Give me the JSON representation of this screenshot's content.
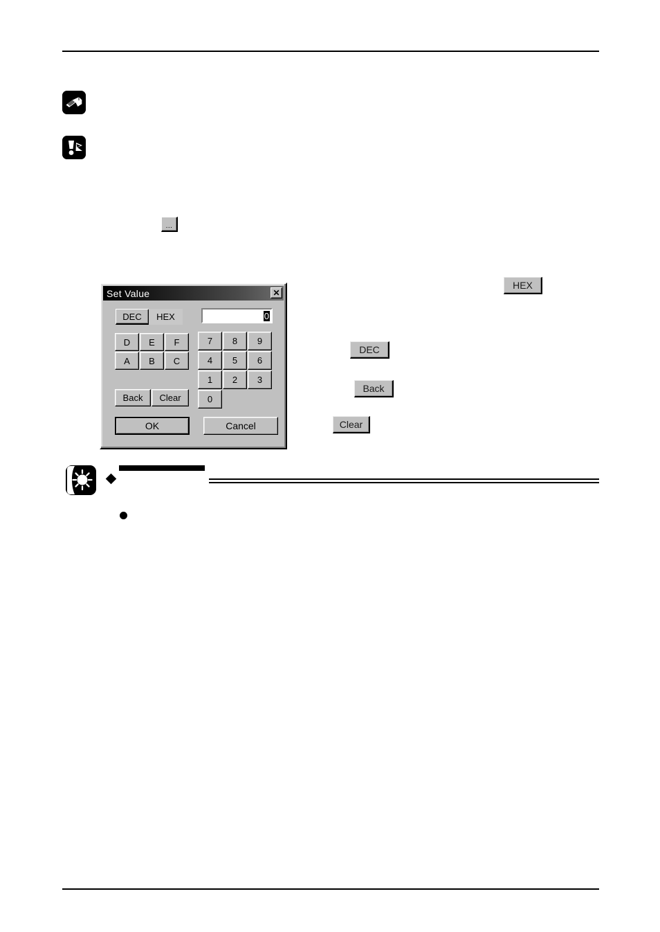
{
  "page": {
    "background_color": "#ffffff",
    "rules": {
      "top_label": "header-rule",
      "bottom_label": "footer-rule"
    }
  },
  "notes": [
    {
      "id": "reference-note",
      "icon": "open-book-icon",
      "label": "Reference note marker"
    },
    {
      "id": "caution-note",
      "icon": "exclamation-warning-icon",
      "label": "Caution note marker"
    }
  ],
  "browse_button": {
    "label": "...",
    "icon": "ellipsis-icon"
  },
  "dialog": {
    "title": "Set Value",
    "close_label": "✕",
    "close_icon": "close-icon",
    "mode": {
      "dec_label": "DEC",
      "hex_label": "HEX",
      "selected": "DEC"
    },
    "value_field": {
      "value": "0",
      "placeholder": ""
    },
    "hex_keys": [
      [
        "D",
        "E",
        "F"
      ],
      [
        "A",
        "B",
        "C"
      ]
    ],
    "num_keys": [
      [
        "7",
        "8",
        "9"
      ],
      [
        "4",
        "5",
        "6"
      ],
      [
        "1",
        "2",
        "3"
      ],
      [
        "0"
      ]
    ],
    "edit_keys": {
      "back_label": "Back",
      "clear_label": "Clear"
    },
    "actions": {
      "ok_label": "OK",
      "cancel_label": "Cancel"
    },
    "colors": {
      "face": "#c0c0c0",
      "shadow": "#808080",
      "highlight": "#ffffff",
      "titlebar_dark": "#000000",
      "titlebar_light": "#6e6e6e",
      "field_background": "#ffffff"
    }
  },
  "callouts": [
    {
      "id": "callout-hex",
      "label": "HEX"
    },
    {
      "id": "callout-dec",
      "label": "DEC"
    },
    {
      "id": "callout-back",
      "label": "Back"
    },
    {
      "id": "callout-clear",
      "label": "Clear"
    }
  ],
  "tip_block": {
    "icon": "sun-tip-icon",
    "diamond_bullet": "◆",
    "round_bullet": "●",
    "redaction_bar": "",
    "double_rule": ""
  }
}
